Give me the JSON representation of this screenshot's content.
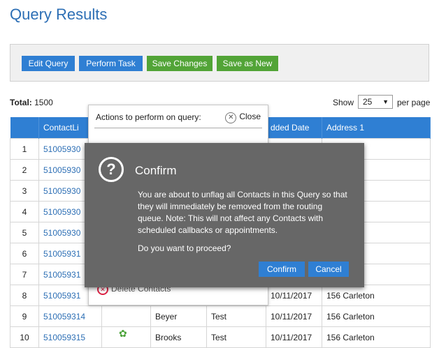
{
  "page": {
    "title": "Query Results"
  },
  "toolbar": {
    "edit_query": "Edit Query",
    "perform_task": "Perform Task",
    "save_changes": "Save Changes",
    "save_as_new": "Save as New"
  },
  "summary": {
    "total_label": "Total:",
    "total_value": "1500",
    "show_label": "Show",
    "per_page_value": "25",
    "per_page_label": "per page"
  },
  "table": {
    "headers": [
      "",
      "ContactLi",
      "",
      "",
      "",
      "dded Date",
      "Address 1"
    ],
    "rows": [
      {
        "n": "1",
        "id": "51005930",
        "last": "",
        "first": "",
        "date": "",
        "addr": "ton"
      },
      {
        "n": "2",
        "id": "51005930",
        "last": "",
        "first": "",
        "date": "",
        "addr": "ton"
      },
      {
        "n": "3",
        "id": "51005930",
        "last": "",
        "first": "",
        "date": "",
        "addr": "ton"
      },
      {
        "n": "4",
        "id": "51005930",
        "last": "",
        "first": "",
        "date": "",
        "addr": "ton"
      },
      {
        "n": "5",
        "id": "51005930",
        "last": "",
        "first": "",
        "date": "",
        "addr": "ton"
      },
      {
        "n": "6",
        "id": "51005931",
        "last": "",
        "first": "",
        "date": "",
        "addr": "ton"
      },
      {
        "n": "7",
        "id": "51005931",
        "last": "",
        "first": "",
        "date": "",
        "addr": "ton"
      },
      {
        "n": "8",
        "id": "51005931",
        "last": "",
        "first": "",
        "date": "10/11/2017",
        "addr": "156 Carleton"
      },
      {
        "n": "9",
        "id": "510059314",
        "last": "Beyer",
        "first": "Test",
        "date": "10/11/2017",
        "addr": "156 Carleton"
      },
      {
        "n": "10",
        "id": "510059315",
        "last": "Brooks",
        "first": "Test",
        "date": "10/11/2017",
        "addr": "156 Carleton"
      }
    ]
  },
  "actions_panel": {
    "title": "Actions to perform on query:",
    "close_label": "Close",
    "delete_label": "Delete Contacts"
  },
  "confirm": {
    "title": "Confirm",
    "message": "You are about to unflag all Contacts in this Query so that they will immediately be removed from the routing queue. Note: This will not affect any Contacts with scheduled callbacks or appointments.",
    "prompt": "Do you want to proceed?",
    "confirm_button": "Confirm",
    "cancel_button": "Cancel"
  },
  "colors": {
    "accent": "#2f7fd3",
    "success": "#52a437",
    "dialog": "#676767"
  }
}
